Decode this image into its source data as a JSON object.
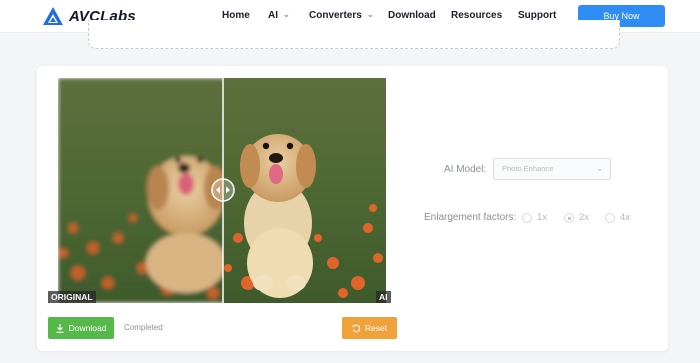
{
  "header": {
    "brand": "AVCLabs",
    "nav": [
      {
        "label": "Home",
        "has_dropdown": false
      },
      {
        "label": "AI",
        "has_dropdown": true
      },
      {
        "label": "Converters",
        "has_dropdown": true,
        "active": true
      },
      {
        "label": "Download",
        "has_dropdown": false
      },
      {
        "label": "Resources",
        "has_dropdown": false
      },
      {
        "label": "Support",
        "has_dropdown": false
      }
    ],
    "buy_label": "Buy Now",
    "accent_color": "#2f8cf5"
  },
  "compare": {
    "left_tag": "ORIGINAL",
    "right_tag": "AI",
    "slider_icon": "compare-handle-icon"
  },
  "actions": {
    "download_label": "Download",
    "status": "Completed",
    "reset_label": "Reset"
  },
  "settings": {
    "model_label": "AI Model:",
    "model_value": "Photo Enhance",
    "factor_label": "Enlargement factors:",
    "factors": [
      {
        "label": "1x",
        "checked": false
      },
      {
        "label": "2x",
        "checked": true
      },
      {
        "label": "4x",
        "checked": false
      }
    ]
  }
}
